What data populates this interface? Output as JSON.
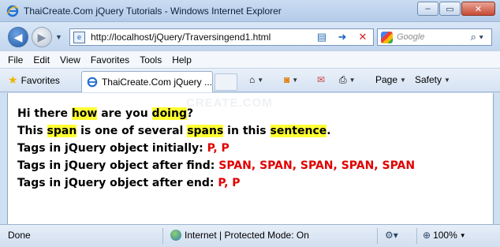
{
  "window": {
    "title": "ThaiCreate.Com jQuery Tutorials - Windows Internet Explorer",
    "controls": {
      "minimize": "‒",
      "maximize": "▭",
      "close": "✕"
    }
  },
  "address": {
    "url": "http://localhost/jQuery/Traversingend1.html",
    "search_placeholder": "Google"
  },
  "menu": [
    "File",
    "Edit",
    "View",
    "Favorites",
    "Tools",
    "Help"
  ],
  "favorites_bar": {
    "favorites_label": "Favorites",
    "tab_label": "ThaiCreate.Com jQuery ...",
    "commands": {
      "page": "Page",
      "safety": "Safety"
    }
  },
  "content": {
    "watermark": "CREATE.COM",
    "line1": {
      "a": "Hi there ",
      "b": "how",
      "c": " are you ",
      "d": "doing",
      "e": "?"
    },
    "line2": {
      "a": "This ",
      "b": "span",
      "c": " is one of several ",
      "d": "spans",
      "e": " in this ",
      "f": "sentence",
      "g": "."
    },
    "line3": {
      "label": "Tags in jQuery object initially: ",
      "value": "P, P"
    },
    "line4": {
      "label": "Tags in jQuery object after find: ",
      "value": "SPAN, SPAN, SPAN, SPAN, SPAN"
    },
    "line5": {
      "label": "Tags in jQuery object after end: ",
      "value": "P, P"
    }
  },
  "status": {
    "left": "Done",
    "zone": "Internet | Protected Mode: On",
    "zoom": "100%"
  },
  "colors": {
    "highlight": "#ffff33",
    "label_blue": "#0000cc",
    "value_red": "#e00000"
  }
}
